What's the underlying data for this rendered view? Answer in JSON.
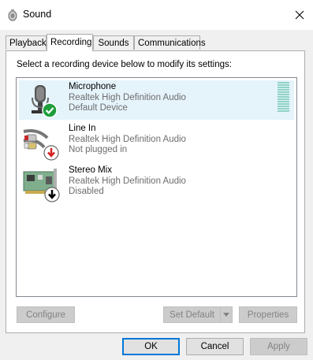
{
  "window": {
    "title": "Sound",
    "title_icon": "speaker-icon",
    "close_icon": "close-icon"
  },
  "tabs": [
    {
      "label": "Playback"
    },
    {
      "label": "Recording"
    },
    {
      "label": "Sounds"
    },
    {
      "label": "Communications"
    }
  ],
  "active_tab": "Recording",
  "panel": {
    "instruction": "Select a recording device below to modify its settings:"
  },
  "devices": [
    {
      "name": "Microphone",
      "driver": "Realtek High Definition Audio",
      "status": "Default Device",
      "icon": "microphone-icon",
      "badge": "check-badge-icon"
    },
    {
      "name": "Line In",
      "driver": "Realtek High Definition Audio",
      "status": "Not plugged in",
      "icon": "rca-cable-icon",
      "badge": "down-arrow-red-badge-icon"
    },
    {
      "name": "Stereo Mix",
      "driver": "Realtek High Definition Audio",
      "status": "Disabled",
      "icon": "sound-card-icon",
      "badge": "down-arrow-black-badge-icon"
    }
  ],
  "buttons": {
    "configure": "Configure",
    "set_default": "Set Default",
    "properties": "Properties",
    "ok": "OK",
    "cancel": "Cancel",
    "apply": "Apply"
  },
  "colors": {
    "selection": "#e5f3fb",
    "accent": "#0078d7",
    "level_meter": "#8fd3c4",
    "check_green": "#1e9e3c",
    "arrow_red": "#d32222"
  }
}
